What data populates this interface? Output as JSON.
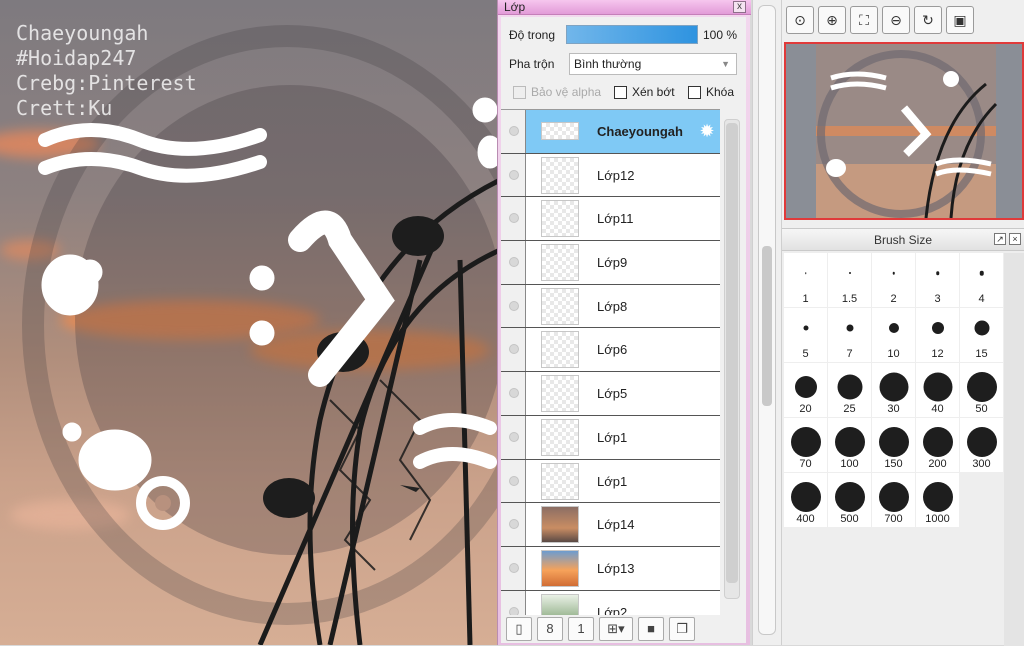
{
  "canvas": {
    "watermark_lines": [
      "Chaeyoungah",
      "#Hoidap247",
      "Crebg:Pinterest",
      "Crett:Ku"
    ]
  },
  "layer_panel": {
    "title": "Lớp",
    "close_label": "x",
    "opacity_label": "Độ trong",
    "opacity_value": "100 %",
    "opacity_fraction": 1.0,
    "blend_label": "Pha trộn",
    "blend_value": "Bình thường",
    "protect_alpha_label": "Bảo vệ alpha",
    "clipping_label": "Xén bớt",
    "lock_label": "Khóa",
    "layers": [
      {
        "name": "Chaeyoungah",
        "active": true,
        "thumb": "text"
      },
      {
        "name": "Lớp12",
        "thumb": "empty"
      },
      {
        "name": "Lớp11",
        "thumb": "empty"
      },
      {
        "name": "Lớp9",
        "thumb": "empty"
      },
      {
        "name": "Lớp8",
        "thumb": "empty"
      },
      {
        "name": "Lớp6",
        "thumb": "empty"
      },
      {
        "name": "Lớp5",
        "thumb": "empty"
      },
      {
        "name": "Lớp1",
        "thumb": "empty"
      },
      {
        "name": "Lớp1",
        "thumb": "empty"
      },
      {
        "name": "Lớp14",
        "thumb": "photo1"
      },
      {
        "name": "Lớp13",
        "thumb": "photo2"
      },
      {
        "name": "Lớp2",
        "thumb": "photo3"
      }
    ],
    "toolbar_icons": [
      "new-layer-icon",
      "new-8bit-layer-icon",
      "new-1bit-layer-icon",
      "add-layer-menu-icon",
      "folder-icon",
      "duplicate-layer-icon"
    ]
  },
  "navigator": {
    "tools": [
      "zoom-actual-icon",
      "zoom-in-icon",
      "fit-window-icon",
      "zoom-out-icon",
      "rotate-icon",
      "fullscreen-icon"
    ]
  },
  "brush_size": {
    "title": "Brush Size",
    "sizes": [
      "1",
      "1.5",
      "2",
      "3",
      "4",
      "5",
      "7",
      "10",
      "12",
      "15",
      "20",
      "25",
      "30",
      "40",
      "50",
      "70",
      "100",
      "150",
      "200",
      "300",
      "400",
      "500",
      "700",
      "1000"
    ]
  }
}
